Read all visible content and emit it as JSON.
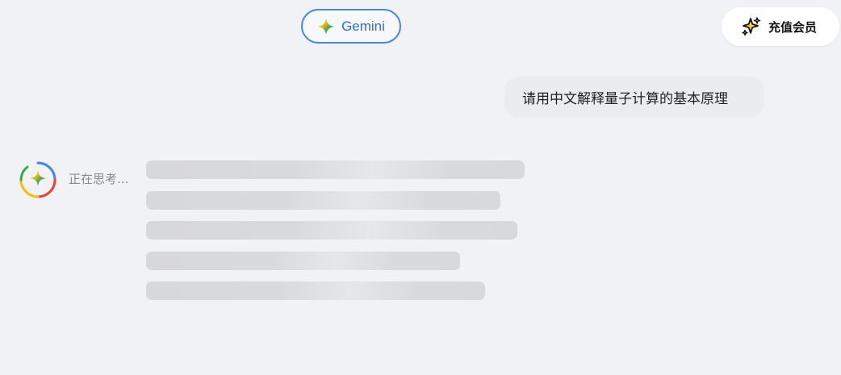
{
  "header": {
    "model_selector": {
      "label": "Gemini",
      "icon": "gemini-sparkle-icon"
    },
    "upgrade_button": {
      "label": "充值会员",
      "icon": "sparkles-icon"
    }
  },
  "conversation": {
    "user_message": "请用中文解释量子计算的基本原理",
    "assistant": {
      "avatar_icon": "gemini-sparkle-icon",
      "status": "正在思考...",
      "skeleton_line_count": 5
    }
  },
  "colors": {
    "background": "#f1f2f6",
    "accent_blue": "#4a86e8",
    "model_label": "#2b6fd6",
    "user_bubble": "#ebecf0",
    "skeleton": "#d7d8dc"
  }
}
